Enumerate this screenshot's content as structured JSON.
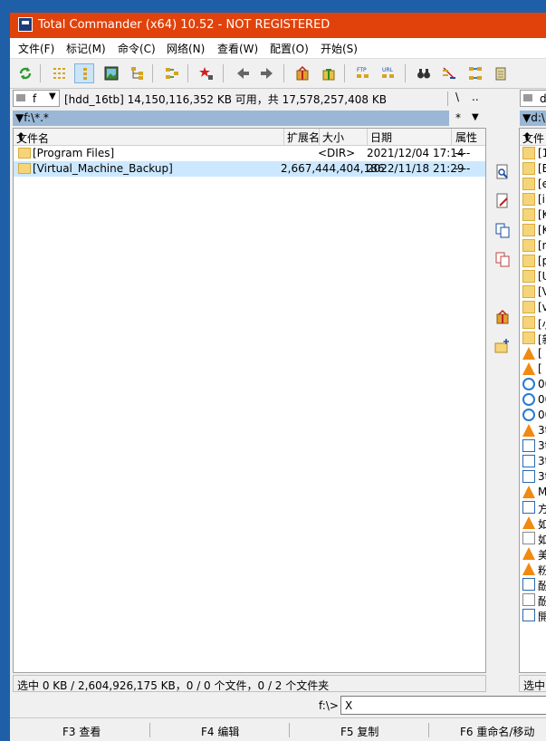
{
  "window": {
    "title": "Total Commander (x64) 10.52 - NOT REGISTERED"
  },
  "menu": [
    "文件(F)",
    "标记(M)",
    "命令(C)",
    "网络(N)",
    "查看(W)",
    "配置(O)",
    "开始(S)"
  ],
  "left": {
    "drive": "f",
    "drive_info": "[hdd_16tb]  14,150,116,352 KB 可用，共 17,578,257,408 KB",
    "root_btn": "\\",
    "up_btn": "..",
    "path": "f:\\*.*",
    "filter": "*",
    "columns": {
      "name": "文件名",
      "ext": "扩展名",
      "size": "大小",
      "date": "日期",
      "attr": "属性"
    },
    "rows": [
      {
        "name": "[Program Files]",
        "size": "<DIR>",
        "date": "2021/12/04 17:14",
        "attr": "----"
      },
      {
        "name": "[Virtual_Machine_Backup]",
        "size": "2,667,444,404,186",
        "date": "2022/11/18 21:29",
        "attr": "----"
      }
    ],
    "status": "选中 0 KB / 2,604,926,175 KB，0 / 0 个文件，0 / 2 个文件夹"
  },
  "right": {
    "drive": "d",
    "path": "d:\\",
    "col_name": "文件",
    "status": "选中",
    "items": [
      "[1",
      "[E",
      "[e",
      "[il",
      "[K",
      "[K",
      "[n",
      "[p",
      "[U",
      "[V",
      "[v",
      "[小",
      "[新",
      "[",
      "[",
      "00",
      "00",
      "00",
      "3t",
      "3t",
      "3t",
      "3t",
      "M",
      "方",
      "如",
      "如",
      "美",
      "粉",
      "酚",
      "酚",
      "開"
    ]
  },
  "cmdline": {
    "prompt": "f:\\>",
    "value": "X"
  },
  "fkeys": [
    "F3 查看",
    "F4 编辑",
    "F5 复制",
    "F6 重命名/移动"
  ]
}
